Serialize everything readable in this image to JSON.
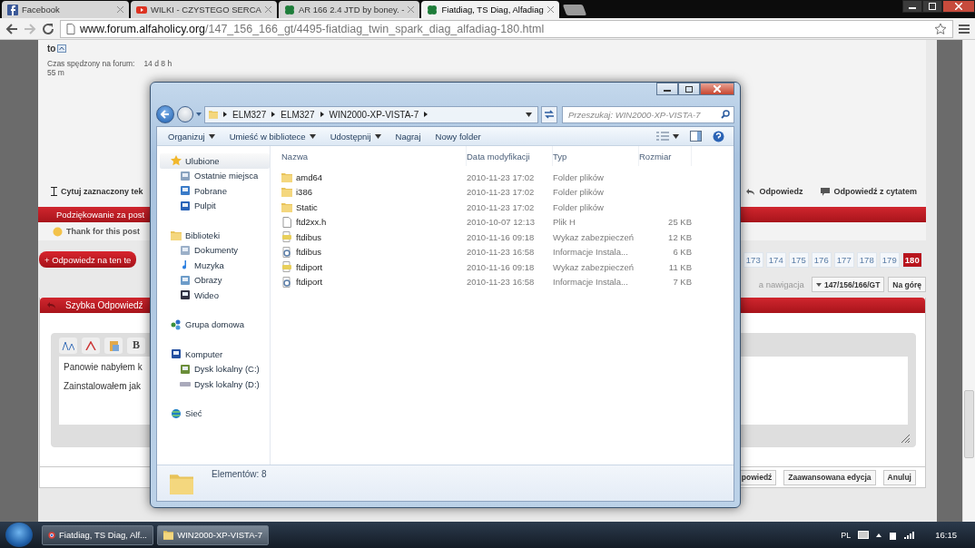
{
  "browser": {
    "tabs": [
      {
        "kind": "facebook",
        "title": "Facebook",
        "selected": false
      },
      {
        "kind": "video",
        "title": "WILKI - CZYSTEGO SERCA",
        "selected": false
      },
      {
        "kind": "clover",
        "title": "AR 166 2.4 JTD by boney. -",
        "selected": false
      },
      {
        "kind": "clover",
        "title": "Fiatdiag, TS Diag, Alfadiag",
        "selected": true
      }
    ],
    "url": {
      "host": "www.forum.alfaholicy.org",
      "path": "/147_156_166_gt/4495-fiatdiag_twin_spark_diag_alfadiag-180.html"
    }
  },
  "forum": {
    "profile": {
      "name": "to",
      "time_label": "Czas spędzony na forum:",
      "time_value": "14 d 8 h",
      "time_value_cont": "55 m"
    },
    "post_actions": {
      "quote_selected": "Cytuj zaznaczony tek",
      "reply": "Odpowiedz",
      "reply_quote": "Odpowiedź z cytatem"
    },
    "thanks_bar": "Podziękowanie za post",
    "thank_button": "Thank for this post",
    "reply_button": "+ Odpowiedz na ten te",
    "pages": [
      {
        "label": "173",
        "selected": false
      },
      {
        "label": "174",
        "selected": false
      },
      {
        "label": "175",
        "selected": false
      },
      {
        "label": "176",
        "selected": false
      },
      {
        "label": "177",
        "selected": false
      },
      {
        "label": "178",
        "selected": false
      },
      {
        "label": "179",
        "selected": false
      },
      {
        "label": "180",
        "selected": true
      }
    ],
    "nav_label": "a nawigacja",
    "forum_jump": "147/156/166/GT",
    "top_button": "Na górę",
    "quick_reply": {
      "title": "Szybka Odpowiedź",
      "bold_tool": "B",
      "lines": [
        "Panowie nabyłem k",
        "Zainstalowałem jak"
      ],
      "buttons": [
        "powiedź",
        "Zaawansowana edycja",
        "Anuluj"
      ]
    }
  },
  "explorer": {
    "breadcrumbs": [
      "ELM327",
      "ELM327",
      "WIN2000-XP-VISTA-7"
    ],
    "search": {
      "placeholder": "Przeszukaj: WIN2000-XP-VISTA-7"
    },
    "commands": [
      {
        "label": "Organizuj",
        "dropdown": true
      },
      {
        "label": "Umieść w bibliotece",
        "dropdown": true
      },
      {
        "label": "Udostępnij",
        "dropdown": true
      },
      {
        "label": "Nagraj",
        "dropdown": false
      },
      {
        "label": "Nowy folder",
        "dropdown": false
      }
    ],
    "nav": [
      {
        "label": "Ulubione",
        "kind": "star",
        "selected": true,
        "children": [
          {
            "label": "Ostatnie miejsca",
            "kind": "recent"
          },
          {
            "label": "Pobrane",
            "kind": "download"
          },
          {
            "label": "Pulpit",
            "kind": "desktop"
          }
        ]
      },
      {
        "label": "Biblioteki",
        "kind": "library",
        "selected": false,
        "children": [
          {
            "label": "Dokumenty",
            "kind": "document"
          },
          {
            "label": "Muzyka",
            "kind": "music"
          },
          {
            "label": "Obrazy",
            "kind": "picture"
          },
          {
            "label": "Wideo",
            "kind": "video"
          }
        ]
      },
      {
        "label": "Grupa domowa",
        "kind": "homegroup",
        "selected": false
      },
      {
        "label": "Komputer",
        "kind": "computer",
        "selected": false,
        "children": [
          {
            "label": "Dysk lokalny (C:)",
            "kind": "systemdrive"
          },
          {
            "label": "Dysk lokalny (D:)",
            "kind": "drive"
          }
        ]
      },
      {
        "label": "Sieć",
        "kind": "network",
        "selected": false
      }
    ],
    "columns": [
      "Nazwa",
      "Data modyfikacji",
      "Typ",
      "Rozmiar"
    ],
    "files": [
      {
        "name": "amd64",
        "kind": "folder",
        "date": "2010-11-23 17:02",
        "type": "Folder plików"
      },
      {
        "name": "i386",
        "kind": "folder",
        "date": "2010-11-23 17:02",
        "type": "Folder plików"
      },
      {
        "name": "Static",
        "kind": "folder",
        "date": "2010-11-23 17:02",
        "type": "Folder plików"
      },
      {
        "name": "ftd2xx.h",
        "kind": "file",
        "date": "2010-10-07 12:13",
        "type": "Plik H",
        "size": "25 KB"
      },
      {
        "name": "ftdibus",
        "kind": "catalog",
        "date": "2010-11-16 09:18",
        "type": "Wykaz zabezpieczeń",
        "size": "12 KB"
      },
      {
        "name": "ftdibus",
        "kind": "setup",
        "date": "2010-11-23 16:58",
        "type": "Informacje Instala...",
        "size": "6 KB"
      },
      {
        "name": "ftdiport",
        "kind": "catalog",
        "date": "2010-11-16 09:18",
        "type": "Wykaz zabezpieczeń",
        "size": "11 KB"
      },
      {
        "name": "ftdiport",
        "kind": "setup",
        "date": "2010-11-23 16:58",
        "type": "Informacje Instala...",
        "size": "7 KB"
      }
    ],
    "status": "Elementów: 8"
  },
  "taskbar": {
    "items": [
      {
        "kind": "browser",
        "label": "Fiatdiag, TS Diag, Alf...",
        "selected": false
      },
      {
        "kind": "folder",
        "label": "WIN2000-XP-VISTA-7",
        "selected": true
      }
    ],
    "language": "PL",
    "time": "16:15"
  }
}
